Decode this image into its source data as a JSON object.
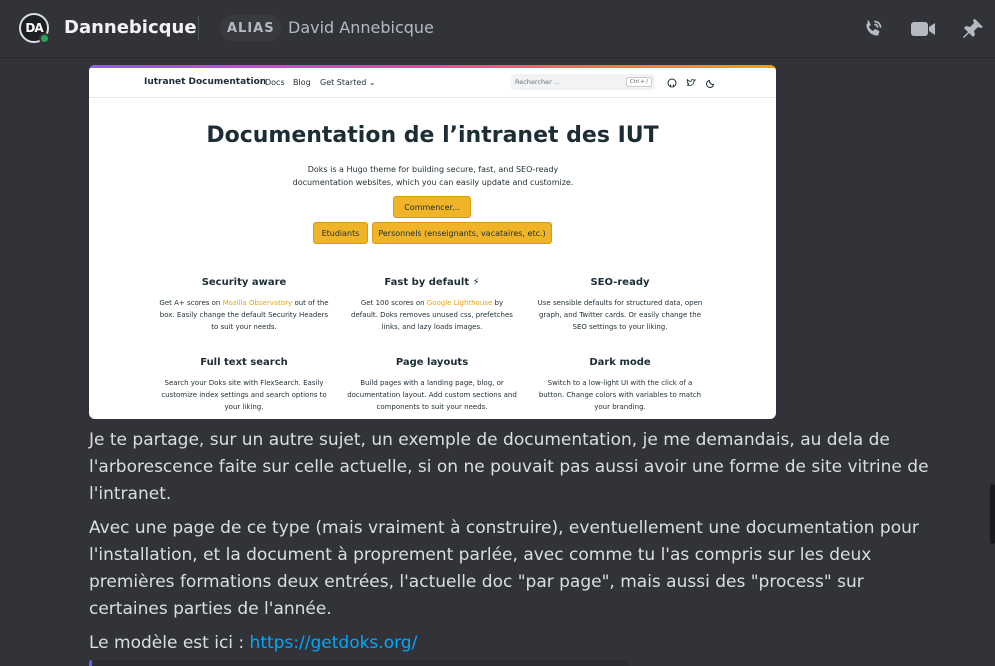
{
  "header": {
    "avatar_initials": "DA",
    "channel_name": "Dannebicque",
    "alias_tag": "ALIAS",
    "alias_name": "David Annebicque",
    "icons": [
      "phone-call-icon",
      "video-camera-icon",
      "pin-icon"
    ]
  },
  "embed": {
    "brand": "Iutranet Documentation",
    "nav": [
      "Docs",
      "Blog",
      "Get Started"
    ],
    "search_placeholder": "Rechercher ...",
    "search_shortcut": "Ctrl + /",
    "title": "Documentation de l’intranet des IUT",
    "lead": "Doks is a Hugo theme for building secure, fast, and SEO-ready documentation websites, which you can easily update and customize.",
    "buttons": {
      "start": "Commencer...",
      "students": "Etudiants",
      "staff": "Personnels (enseignants, vacataires, etc.)"
    },
    "features": [
      {
        "title": "Security aware",
        "pre": "Get A+ scores on ",
        "link": "Mozilla Observatory",
        "post": " out of the box. Easily change the default Security Headers to suit your needs."
      },
      {
        "title": "Fast by default ⚡",
        "pre": "Get 100 scores on ",
        "link": "Google Lighthouse",
        "post": " by default. Doks removes unused css, prefetches links, and lazy loads images."
      },
      {
        "title": "SEO-ready",
        "pre": "Use sensible defaults for structured data, open graph, and Twitter cards. Or easily change the SEO settings to your liking.",
        "link": "",
        "post": ""
      },
      {
        "title": "Full text search",
        "pre": "Search your Doks site with FlexSearch. Easily customize index settings and search options to your liking.",
        "link": "",
        "post": ""
      },
      {
        "title": "Page layouts",
        "pre": "Build pages with a landing page, blog, or documentation layout. Add custom sections and components to suit your needs.",
        "link": "",
        "post": ""
      },
      {
        "title": "Dark mode",
        "pre": "Switch to a low-light UI with the click of a button. Change colors with variables to match your branding.",
        "link": "",
        "post": ""
      }
    ]
  },
  "message": {
    "para1": "Je te partage, sur un autre sujet, un exemple de documentation, je me demandais, au dela de l'arborescence faite sur celle actuelle, si on ne pouvait pas aussi avoir une forme de site vitrine de l'intranet.",
    "para2": "Avec une page de ce type (mais vraiment à construire), eventuellement une documentation pour l'installation, et la document à proprement parlée, avec comme tu l'as compris sur les deux premières formations deux entrées, l'actuelle doc \"par page\", mais aussi des \"process\" sur certaines parties de l'année.",
    "para3_prefix": "Le modèle est ici : ",
    "para3_link": "https://getdoks.org/"
  }
}
